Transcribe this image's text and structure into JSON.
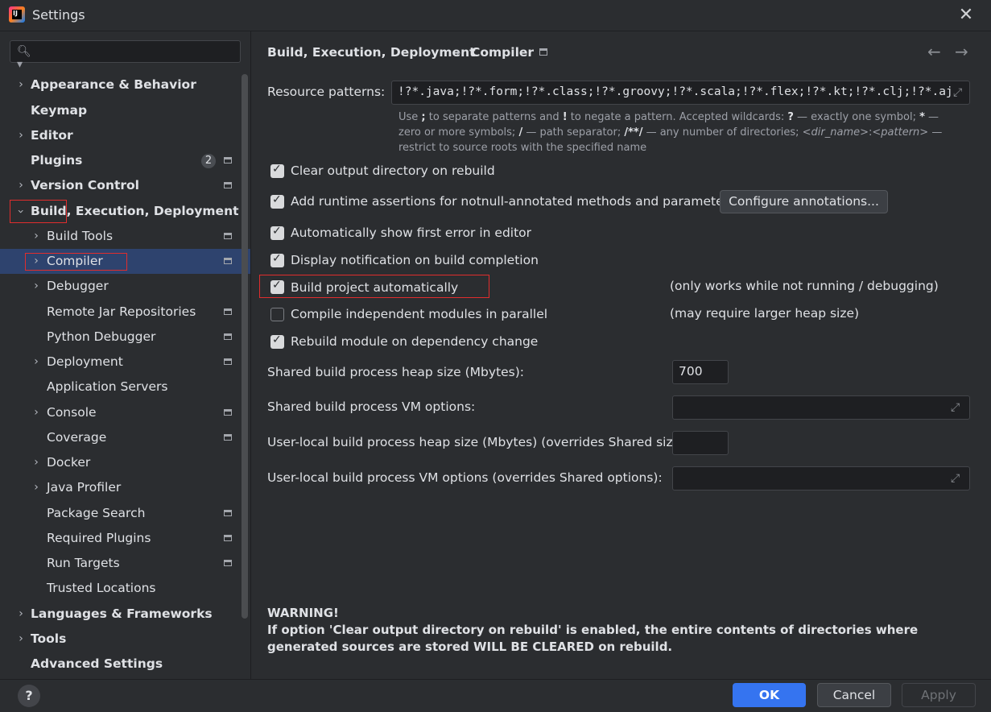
{
  "window": {
    "title": "Settings",
    "close_glyph": "✕"
  },
  "search": {
    "placeholder": ""
  },
  "sidebar": {
    "items": [
      {
        "label": "Appearance & Behavior"
      },
      {
        "label": "Keymap"
      },
      {
        "label": "Editor"
      },
      {
        "label": "Plugins",
        "badge": "2"
      },
      {
        "label": "Version Control"
      },
      {
        "label": "Build, Execution, Deployment"
      },
      {
        "label": "Build Tools"
      },
      {
        "label": "Compiler"
      },
      {
        "label": "Debugger"
      },
      {
        "label": "Remote Jar Repositories"
      },
      {
        "label": "Python Debugger"
      },
      {
        "label": "Deployment"
      },
      {
        "label": "Application Servers"
      },
      {
        "label": "Console"
      },
      {
        "label": "Coverage"
      },
      {
        "label": "Docker"
      },
      {
        "label": "Java Profiler"
      },
      {
        "label": "Package Search"
      },
      {
        "label": "Required Plugins"
      },
      {
        "label": "Run Targets"
      },
      {
        "label": "Trusted Locations"
      },
      {
        "label": "Languages & Frameworks"
      },
      {
        "label": "Tools"
      },
      {
        "label": "Advanced Settings"
      }
    ]
  },
  "breadcrumb": {
    "parent": "Build, Execution, Deployment",
    "current": "Compiler",
    "separator": "›"
  },
  "nav": {
    "back": "←",
    "forward": "→"
  },
  "compiler": {
    "resource_patterns_label": "Resource patterns:",
    "resource_patterns_value": "!?*.java;!?*.form;!?*.class;!?*.groovy;!?*.scala;!?*.flex;!?*.kt;!?*.clj;!?*.aj",
    "hint": {
      "p1": "Use ",
      "semi": ";",
      "p2": " to separate patterns and ",
      "bang": "!",
      "p3": " to negate a pattern. Accepted wildcards: ",
      "q": "?",
      "p4": " — exactly one symbol; ",
      "star": "*",
      "p5": " — zero or more symbols; ",
      "slash": "/",
      "p6": " — path separator; ",
      "dstar": "/**/",
      "p7": " — any number of directories; ",
      "dir": "<dir_name>",
      "colon": ":",
      "pat": "<pattern>",
      "p8": " — restrict to source roots with the specified name"
    },
    "checkboxes": [
      {
        "label": "Clear output directory on rebuild",
        "checked": true
      },
      {
        "label": "Add runtime assertions for notnull-annotated methods and parameters",
        "checked": true
      },
      {
        "label": "Automatically show first error in editor",
        "checked": true
      },
      {
        "label": "Display notification on build completion",
        "checked": true
      },
      {
        "label": "Build project automatically",
        "checked": true,
        "note": "(only works while not running / debugging)"
      },
      {
        "label": "Compile independent modules in parallel",
        "checked": false,
        "note": "(may require larger heap size)"
      },
      {
        "label": "Rebuild module on dependency change",
        "checked": true
      }
    ],
    "configure_annotations": "Configure annotations...",
    "shared_heap_label": "Shared build process heap size (Mbytes):",
    "shared_heap_value": "700",
    "shared_vm_label": "Shared build process VM options:",
    "user_heap_label": "User-local build process heap size (Mbytes) (overrides Shared size):",
    "user_vm_label": "User-local build process VM options (overrides Shared options):",
    "warning_title": "WARNING!",
    "warning_text": "If option 'Clear output directory on rebuild' is enabled, the entire contents of directories where generated sources are stored WILL BE CLEARED on rebuild."
  },
  "footer": {
    "help": "?",
    "ok": "OK",
    "cancel": "Cancel",
    "apply": "Apply"
  },
  "colors": {
    "accent": "#3574f0",
    "selection": "#2e436e",
    "highlight_box": "#e02d2d",
    "background": "#2b2d30"
  }
}
